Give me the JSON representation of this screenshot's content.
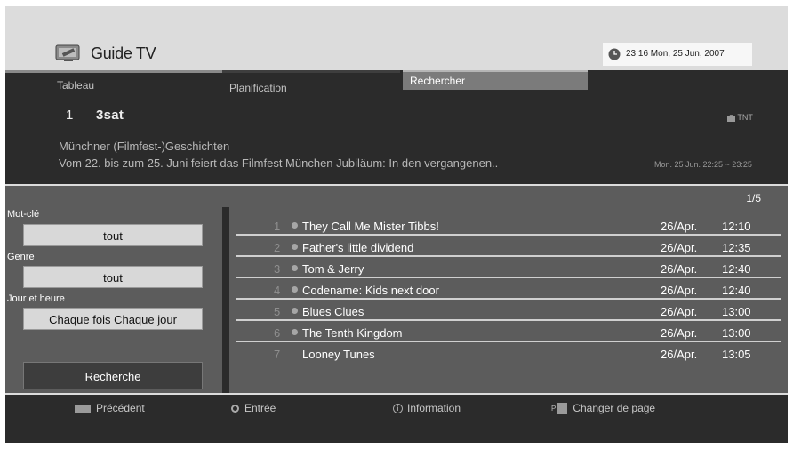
{
  "header": {
    "title": "Guide TV",
    "datetime": "23:16 Mon, 25 Jun, 2007"
  },
  "tabs": [
    {
      "label": "Tableau"
    },
    {
      "label": "Planification"
    },
    {
      "label": "Rechercher",
      "active": true
    }
  ],
  "current": {
    "channel_number": "1",
    "channel_name": "3sat",
    "source": "TNT",
    "program_title": "Münchner (Filmfest-)Geschichten",
    "description": "Vom 22. bis zum 25. Juni feiert das Filmfest München Jubiläum: In den vergangenen..",
    "time": "Mon. 25 Jun. 22:25 ~ 23:25"
  },
  "page_indicator": "1/5",
  "filters": {
    "keyword_label": "Mot-clé",
    "keyword_value": "tout",
    "genre_label": "Genre",
    "genre_value": "tout",
    "day_time_label": "Jour et heure",
    "day_time_value": "Chaque fois  Chaque jour",
    "search_button": "Recherche"
  },
  "results": [
    {
      "num": "1",
      "title": "They Call Me Mister Tibbs!",
      "date": "26/Apr.",
      "time": "12:10"
    },
    {
      "num": "2",
      "title": "Father's little dividend",
      "date": "26/Apr.",
      "time": "12:35"
    },
    {
      "num": "3",
      "title": "Tom & Jerry",
      "date": "26/Apr.",
      "time": "12:40"
    },
    {
      "num": "4",
      "title": "Codename: Kids next door",
      "date": "26/Apr.",
      "time": "12:40"
    },
    {
      "num": "5",
      "title": "Blues Clues",
      "date": "26/Apr.",
      "time": "13:00"
    },
    {
      "num": "6",
      "title": "The Tenth Kingdom",
      "date": "26/Apr.",
      "time": "13:00"
    },
    {
      "num": "7",
      "title": "Looney Tunes",
      "date": "26/Apr.",
      "time": "13:05"
    }
  ],
  "footer": {
    "prev": "Précédent",
    "enter": "Entrée",
    "info": "Information",
    "info_glyph": "i",
    "page_prefix": "P",
    "page": "Changer de page"
  }
}
